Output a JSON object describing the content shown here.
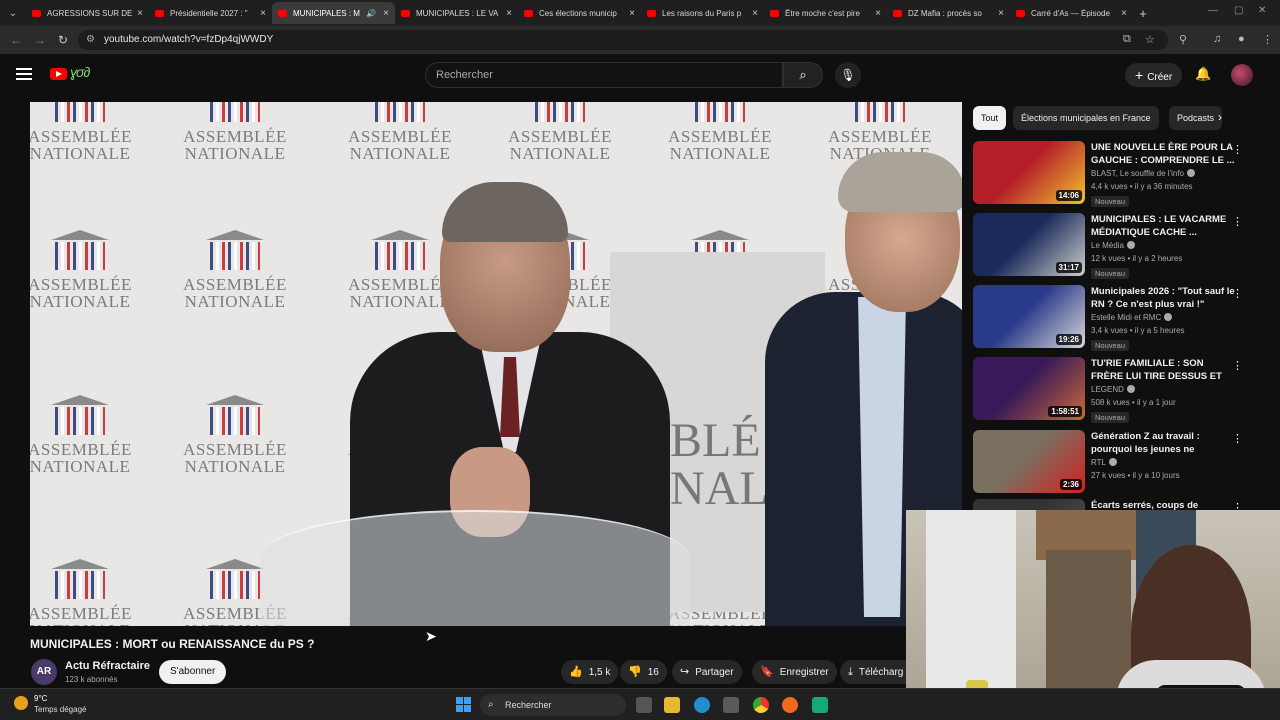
{
  "browser": {
    "tabs": [
      {
        "title": "AGRESSIONS SUR DE",
        "active": false
      },
      {
        "title": "Présidentielle 2027 : \"",
        "active": false
      },
      {
        "title": "MUNICIPALES : M",
        "active": true
      },
      {
        "title": "MUNICIPALES : LE VA",
        "active": false
      },
      {
        "title": "Ces élections municip",
        "active": false
      },
      {
        "title": "Les raisons du Paris p",
        "active": false
      },
      {
        "title": "Être moche c'est pire",
        "active": false
      },
      {
        "title": "DZ Mafia : procès so",
        "active": false
      },
      {
        "title": "Carré d'As — Épisode",
        "active": false
      }
    ],
    "url": "youtube.com/watch?v=fzDp4qjWWDY"
  },
  "youtube": {
    "search_placeholder": "Rechercher",
    "create_label": "Créer"
  },
  "video": {
    "sign_words": [
      "ASSEMBLÉE",
      "NATIONALE"
    ],
    "big_sign_text": "BLÉ\nNAL",
    "title": "MUNICIPALES : MORT ou RENAISSANCE du PS ?",
    "channel": {
      "avatar_text": "AR",
      "name": "Actu Réfractaire",
      "subscribers": "123 k abonnés"
    },
    "subscribe_label": "S'abonner",
    "likes": "1,5 k",
    "dislikes": "16",
    "share_label": "Partager",
    "save_label": "Enregistrer",
    "download_label": "Télécharg"
  },
  "sidebar": {
    "chips": [
      "Tout",
      "Élections municipales en France",
      "Podcasts"
    ],
    "recommendations": [
      {
        "title": "UNE NOUVELLE ÈRE POUR LA GAUCHE : COMPRENDRE LE ...",
        "channel": "BLAST, Le souffle de l'info",
        "meta": "4,4 k vues • il y a 36 minutes",
        "badge": "Nouveau",
        "duration": "14:06",
        "thumb_colors": [
          "#b41f2a",
          "#f2c230"
        ]
      },
      {
        "title": "MUNICIPALES : LE VACARME MÉDIATIQUE CACHE ...",
        "channel": "Le Média",
        "meta": "12 k vues • il y a 2 heures",
        "badge": "Nouveau",
        "duration": "31:17",
        "thumb_colors": [
          "#1a2a5a",
          "#cfcfcf"
        ]
      },
      {
        "title": "Municipales 2026 : \"Tout sauf le RN ? Ce n'est plus vrai !\"",
        "channel": "Estelle Midi et RMC",
        "meta": "3,4 k vues • il y a 5 heures",
        "badge": "Nouveau",
        "duration": "19:26",
        "thumb_colors": [
          "#2a3a8a",
          "#d8d8d8"
        ]
      },
      {
        "title": "TU'RIE FAMILIALE : SON FRÈRE LUI TIRE DESSUS ET ABAT ...",
        "channel": "LEGEND",
        "meta": "508 k vues • il y a 1 jour",
        "badge": "Nouveau",
        "duration": "1:58:51",
        "thumb_colors": [
          "#3a1a5a",
          "#c96a3a"
        ]
      },
      {
        "title": "Génération Z au travail : pourquoi les jeunes ne veulent...",
        "channel": "RTL",
        "meta": "27 k vues • il y a 10 jours",
        "badge": "",
        "duration": "2:36",
        "thumb_colors": [
          "#7a7060",
          "#d42020"
        ]
      },
      {
        "title": "Écarts serrés, coups de",
        "channel": "",
        "meta": "",
        "badge": "",
        "duration": "",
        "thumb_colors": [
          "#333333",
          "#555555"
        ]
      }
    ]
  },
  "taskbar": {
    "temperature": "9°C",
    "weather": "Temps dégagé",
    "search_label": "Rechercher"
  },
  "colors": {
    "background": "#0f0f0f",
    "youtube_red": "#ff0000",
    "chip_bg": "#272727"
  }
}
